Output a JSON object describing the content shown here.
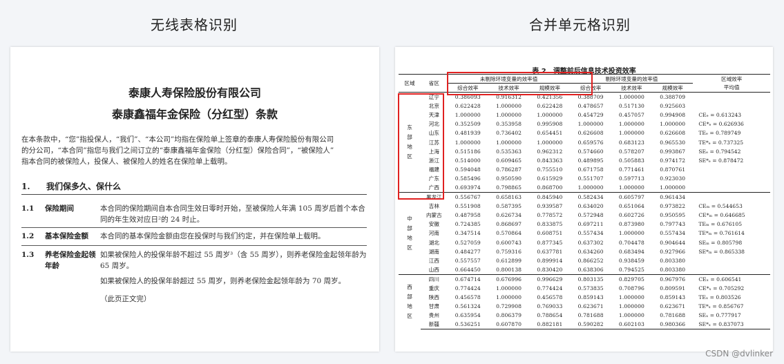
{
  "headings": {
    "left": "无线表格识别",
    "right": "合并单元格识别"
  },
  "document": {
    "company": "泰康人寿保险股份有限公司",
    "product": "泰康鑫福年金保险（分红型）条款",
    "intro": [
      "在本条款中，“您”指投保人，“我们”、“本公司”均指在保险单上签章的泰康人寿保险股份有限公司",
      "的分公司，“本合同”指您与我们之间订立的“泰康鑫福年金保险（分红型）保险合同”，“被保险人”",
      "指本合同的被保险人，投保人、被保险人的姓名在保险单上载明。"
    ],
    "section": {
      "number": "1.",
      "title": "我们保多久、保什么"
    },
    "clauses": [
      {
        "number": "1.1",
        "name": "保险期间",
        "text": "本合同的保险期间自本合同生效日零时开始，至被保险人年满 105 周岁后首个本合同的年生效对应日²的 24 时止。"
      },
      {
        "number": "1.2",
        "name": "基本保险金额",
        "text": "本合同的基本保险金额由您在投保时与我们约定，并在保险单上载明。"
      },
      {
        "number": "1.3",
        "name": "养老保险金起领年龄",
        "text": "如果被保险人的投保年龄不超过 55 周岁³（含 55 周岁），则养老保险金起领年龄为 65 周岁。",
        "text2": "如果被保险人的投保年龄超过 55 周岁，则养老保险金起领年龄为 70 周岁。",
        "end_note": "（此页正文完）"
      }
    ]
  },
  "table": {
    "caption": "表 2　调整前后信息技术投资效率",
    "headers": {
      "region": "区域",
      "province": "省区",
      "group1": "未剔除环境变量的效率值",
      "group2": "剔除环境变量的效率值",
      "avg": "区域效率",
      "avg2": "平均值",
      "col1": "综合效率",
      "col2": "技术效率",
      "col3": "规模效率",
      "col4": "综合效率",
      "col5": "技术效率",
      "col6": "规模效率"
    },
    "groups": [
      {
        "region": "东部地区",
        "rows": [
          [
            "辽宁",
            "0.386093",
            "0.916312",
            "0.421356",
            "0.388709",
            "1.000000",
            "0.388709"
          ],
          [
            "北京",
            "0.622428",
            "1.000000",
            "0.622428",
            "0.478657",
            "0.517130",
            "0.925603"
          ],
          [
            "天津",
            "1.000000",
            "1.000000",
            "1.000000",
            "0.454729",
            "0.457057",
            "0.994908"
          ],
          [
            "河北",
            "0.352509",
            "0.353958",
            "0.995908",
            "1.000000",
            "1.000000",
            "1.000000"
          ],
          [
            "山东",
            "0.481939",
            "0.736402",
            "0.654451",
            "0.626608",
            "1.000000",
            "0.626608"
          ],
          [
            "江苏",
            "1.000000",
            "1.000000",
            "1.000000",
            "0.659576",
            "0.683123",
            "0.965530"
          ],
          [
            "上海",
            "0.515186",
            "0.535363",
            "0.962312",
            "0.574660",
            "0.578207",
            "0.993867"
          ],
          [
            "浙江",
            "0.514000",
            "0.609465",
            "0.843363",
            "0.489895",
            "0.505883",
            "0.974172"
          ],
          [
            "福建",
            "0.594048",
            "0.786287",
            "0.755510",
            "0.671758",
            "0.771461",
            "0.870761"
          ],
          [
            "广东",
            "0.585496",
            "0.950590",
            "0.615929",
            "0.551707",
            "0.597713",
            "0.923030"
          ],
          [
            "广西",
            "0.693974",
            "0.798865",
            "0.868700",
            "1.000000",
            "1.000000",
            "1.000000"
          ]
        ],
        "averages": [
          "CEₑ = 0.613243",
          "CE*ₑ = 0.626936",
          "TEₑ = 0.789749",
          "TE*ₑ = 0.737325",
          "SEₑ = 0.794542",
          "SE*ₑ = 0.878472"
        ]
      },
      {
        "region": "中部地区",
        "rows": [
          [
            "黑龙江",
            "0.556767",
            "0.658163",
            "0.845940",
            "0.582434",
            "0.605797",
            "0.961434"
          ],
          [
            "吉林",
            "0.551908",
            "0.587395",
            "0.939587",
            "0.634020",
            "0.651064",
            "0.973822"
          ],
          [
            "内蒙古",
            "0.487958",
            "0.626734",
            "0.778572",
            "0.572948",
            "0.602726",
            "0.950595"
          ],
          [
            "安徽",
            "0.724385",
            "0.868697",
            "0.833875",
            "0.697211",
            "0.873980",
            "0.797743"
          ],
          [
            "河南",
            "0.347514",
            "0.570864",
            "0.608751",
            "0.557434",
            "1.000000",
            "0.557434"
          ],
          [
            "湖北",
            "0.527059",
            "0.600743",
            "0.877345",
            "0.637302",
            "0.704478",
            "0.904644"
          ],
          [
            "湖南",
            "0.484277",
            "0.759316",
            "0.637781",
            "0.634260",
            "0.683494",
            "0.927966"
          ],
          [
            "江西",
            "0.557557",
            "0.612899",
            "0.899914",
            "0.866252",
            "0.938459",
            "0.803380"
          ],
          [
            "山西",
            "0.664450",
            "0.800138",
            "0.830420",
            "0.638306",
            "0.794525",
            "0.803380"
          ]
        ],
        "averages": [
          "CEₘ = 0.544653",
          "CE*ₘ = 0.646685",
          "TEₘ = 0.676105",
          "TE*ₘ = 0.761614",
          "SEₘ = 0.805798",
          "SE*ₘ = 0.865338"
        ]
      },
      {
        "region": "西部地区",
        "rows": [
          [
            "四川",
            "0.674714",
            "0.676996",
            "0.996629",
            "0.803135",
            "0.829705",
            "0.967976"
          ],
          [
            "重庆",
            "0.774424",
            "1.000000",
            "0.774424",
            "0.573835",
            "0.708796",
            "0.809591"
          ],
          [
            "陕西",
            "0.456578",
            "1.000000",
            "0.456578",
            "0.859143",
            "1.000000",
            "0.859143"
          ],
          [
            "甘肃",
            "0.561324",
            "0.729908",
            "0.769033",
            "0.623671",
            "1.000000",
            "0.623671"
          ],
          [
            "贵州",
            "0.635954",
            "0.806379",
            "0.788654",
            "0.781688",
            "1.000000",
            "0.781688"
          ],
          [
            "新疆",
            "0.536251",
            "0.607870",
            "0.882181",
            "0.590282",
            "0.602103",
            "0.980366"
          ]
        ],
        "averages": [
          "CEₓ = 0.606541",
          "CE*ₓ = 0.705292",
          "TEₓ = 0.803526",
          "TE*ₓ = 0.856767",
          "SEₓ = 0.777917",
          "SE*ₓ = 0.837073"
        ]
      }
    ]
  },
  "watermark": "CSDN @dvlinker",
  "highlight_color": "#e02020"
}
